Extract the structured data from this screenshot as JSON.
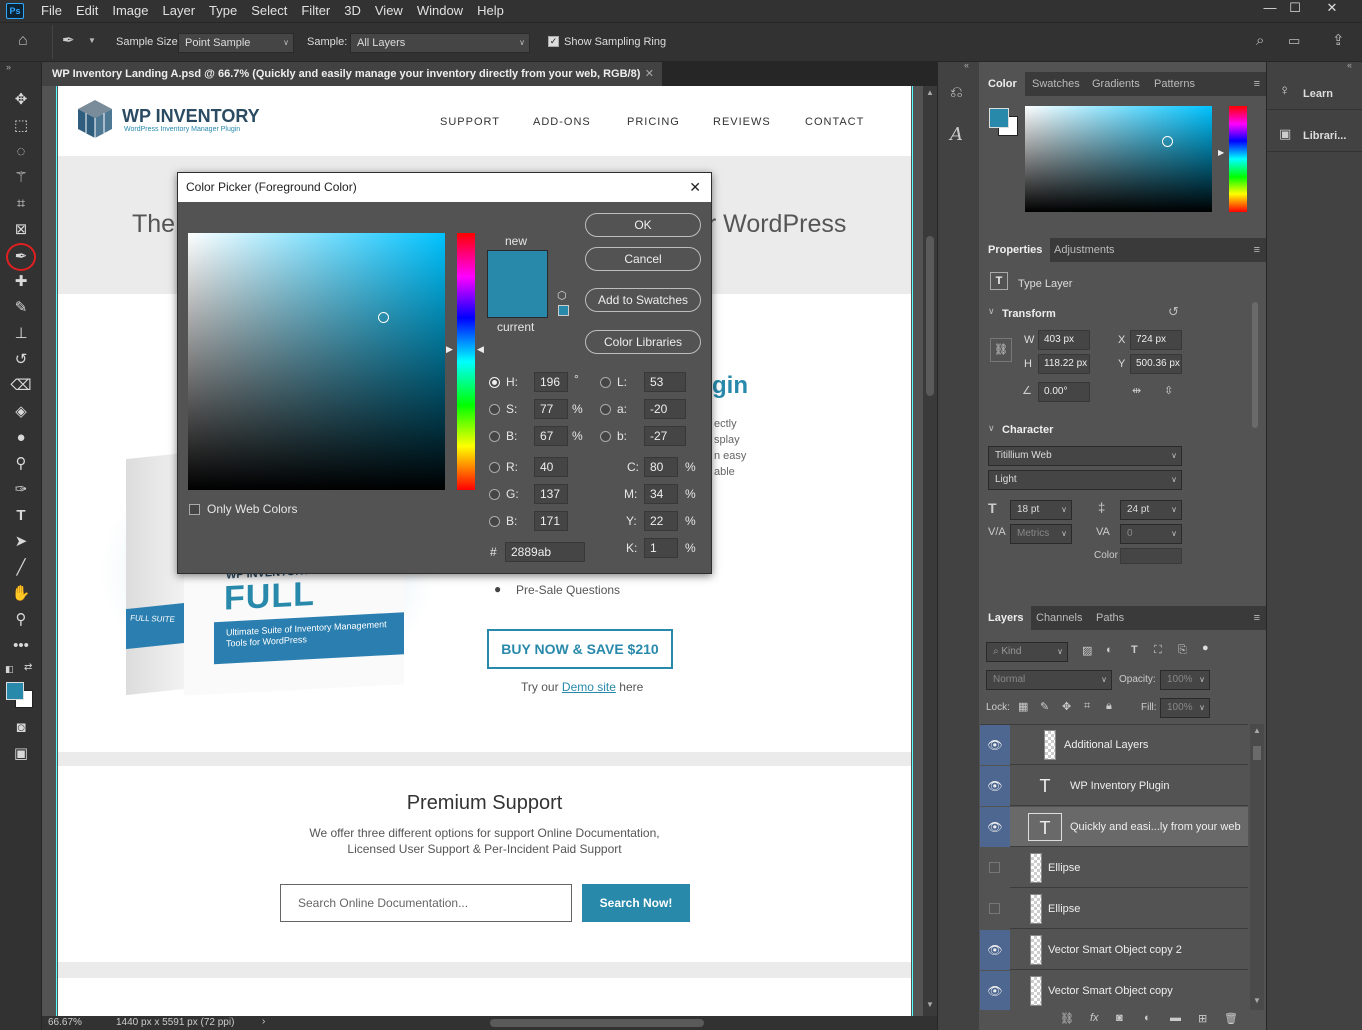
{
  "app": {
    "logo_text": "Ps"
  },
  "menu": [
    "File",
    "Edit",
    "Image",
    "Layer",
    "Type",
    "Select",
    "Filter",
    "3D",
    "View",
    "Window",
    "Help"
  ],
  "options_bar": {
    "sample_size_label": "Sample Size:",
    "sample_size_value": "Point Sample",
    "sample_label": "Sample:",
    "sample_value": "All Layers",
    "show_sampling_ring_label": "Show Sampling Ring",
    "show_sampling_ring_checked": true
  },
  "document": {
    "tab_title": "WP Inventory Landing A.psd @ 66.7% (Quickly and easily manage your inventory directly from your web, RGB/8)",
    "zoom": "66.67%",
    "size_info": "1440 px x 5591 px (72 ppi)"
  },
  "website": {
    "logo_main": "WP INVENTORY",
    "logo_sub": "WordPress Inventory Manager Plugin",
    "nav": [
      "SUPPORT",
      "ADD-ONS",
      "PRICING",
      "REVIEWS",
      "CONTACT"
    ],
    "hero_left": "The",
    "hero_right": "or WordPress",
    "plugin_title_fragment": "gin",
    "desc_fragments": [
      "ectly",
      "splay",
      "n easy",
      "able"
    ],
    "box_brand": "WP INVENTORY",
    "box_title": "FULL SUITE",
    "box_subtitle": "Ultimate Suite of Inventory Management Tools for WordPress",
    "box_side": "FULL SUITE",
    "presale": "Pre-Sale Questions",
    "buy_button": "BUY NOW & SAVE $210",
    "demo_prefix": "Try our ",
    "demo_link": "Demo site",
    "demo_suffix": " here",
    "support_title": "Premium Support",
    "support_line1": "We offer three different options for support Online Documentation,",
    "support_line2": "Licensed User Support & Per-Incident Paid Support",
    "search_placeholder": "Search Online Documentation...",
    "search_button": "Search Now!"
  },
  "color_picker": {
    "title": "Color Picker (Foreground Color)",
    "close": "✕",
    "ok": "OK",
    "cancel": "Cancel",
    "add_to_swatches": "Add to Swatches",
    "color_libraries": "Color Libraries",
    "new_label": "new",
    "current_label": "current",
    "only_web_colors": "Only Web Colors",
    "new_color": "#2889ab",
    "current_color": "#2889ab",
    "hue_base": "#00c3ff",
    "fields": {
      "H": "196",
      "S": "77",
      "B": "67",
      "R": "40",
      "G": "137",
      "B2": "171",
      "L": "53",
      "a": "-20",
      "b": "-27",
      "C": "80",
      "M": "34",
      "Y": "22",
      "K": "1",
      "hex": "2889ab"
    },
    "labels": {
      "H": "H:",
      "S": "S:",
      "B": "B:",
      "R": "R:",
      "G": "G:",
      "B2": "B:",
      "L": "L:",
      "a": "a:",
      "b": "b:",
      "C": "C:",
      "M": "M:",
      "Y": "Y:",
      "K": "K:",
      "hex": "#",
      "deg": "°",
      "pct": "%"
    }
  },
  "color_panel": {
    "tabs": [
      "Color",
      "Swatches",
      "Gradients",
      "Patterns"
    ],
    "foreground": "#2889ab",
    "background": "#ffffff"
  },
  "learn_panel": {
    "items": [
      "Learn",
      "Librari..."
    ]
  },
  "properties": {
    "tabs": [
      "Properties",
      "Adjustments"
    ],
    "layer_type": "Type Layer",
    "transform_label": "Transform",
    "W_label": "W",
    "W": "403 px",
    "H_label": "H",
    "H": "118.22 px",
    "X_label": "X",
    "X": "724 px",
    "Y_label": "Y",
    "Y": "500.36 px",
    "angle": "0.00°",
    "character_label": "Character",
    "font": "Titillium Web",
    "style": "Light",
    "size": "18 pt",
    "leading": "24 pt",
    "kerning": "Metrics",
    "tracking": "0",
    "color_label": "Color"
  },
  "layers": {
    "tabs": [
      "Layers",
      "Channels",
      "Paths"
    ],
    "kind": "Kind",
    "blend": "Normal",
    "opacity_label": "Opacity:",
    "opacity": "100%",
    "lock_label": "Lock:",
    "fill_label": "Fill:",
    "fill": "100%",
    "items": [
      {
        "name": "Additional Layers",
        "visible": true
      },
      {
        "name": "WP Inventory Plugin",
        "visible": true
      },
      {
        "name": "Quickly and easi...ly from your web",
        "visible": true
      },
      {
        "name": "Ellipse",
        "visible": false
      },
      {
        "name": "Ellipse",
        "visible": false
      },
      {
        "name": "Vector Smart Object copy 2",
        "visible": true
      },
      {
        "name": "Vector Smart Object copy",
        "visible": true
      }
    ]
  }
}
